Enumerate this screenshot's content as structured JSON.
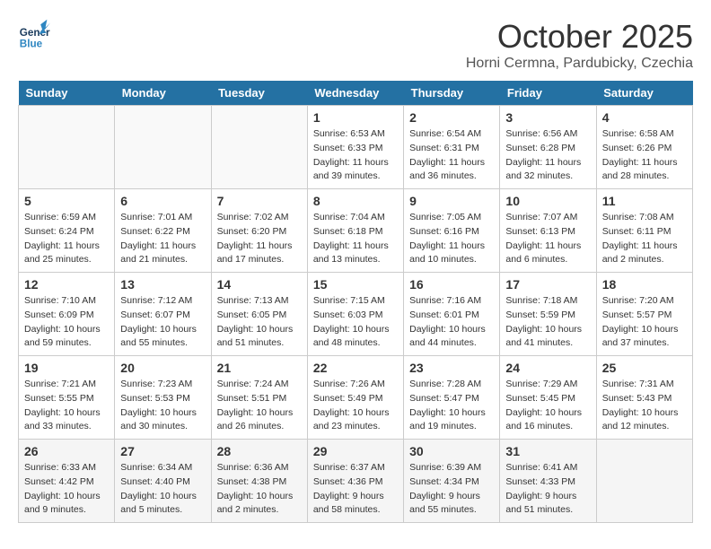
{
  "header": {
    "logo_general": "General",
    "logo_blue": "Blue",
    "month_title": "October 2025",
    "subtitle": "Horni Cermna, Pardubicky, Czechia"
  },
  "days_of_week": [
    "Sunday",
    "Monday",
    "Tuesday",
    "Wednesday",
    "Thursday",
    "Friday",
    "Saturday"
  ],
  "weeks": [
    [
      {
        "date": "",
        "info": ""
      },
      {
        "date": "",
        "info": ""
      },
      {
        "date": "",
        "info": ""
      },
      {
        "date": "1",
        "info": "Sunrise: 6:53 AM\nSunset: 6:33 PM\nDaylight: 11 hours\nand 39 minutes."
      },
      {
        "date": "2",
        "info": "Sunrise: 6:54 AM\nSunset: 6:31 PM\nDaylight: 11 hours\nand 36 minutes."
      },
      {
        "date": "3",
        "info": "Sunrise: 6:56 AM\nSunset: 6:28 PM\nDaylight: 11 hours\nand 32 minutes."
      },
      {
        "date": "4",
        "info": "Sunrise: 6:58 AM\nSunset: 6:26 PM\nDaylight: 11 hours\nand 28 minutes."
      }
    ],
    [
      {
        "date": "5",
        "info": "Sunrise: 6:59 AM\nSunset: 6:24 PM\nDaylight: 11 hours\nand 25 minutes."
      },
      {
        "date": "6",
        "info": "Sunrise: 7:01 AM\nSunset: 6:22 PM\nDaylight: 11 hours\nand 21 minutes."
      },
      {
        "date": "7",
        "info": "Sunrise: 7:02 AM\nSunset: 6:20 PM\nDaylight: 11 hours\nand 17 minutes."
      },
      {
        "date": "8",
        "info": "Sunrise: 7:04 AM\nSunset: 6:18 PM\nDaylight: 11 hours\nand 13 minutes."
      },
      {
        "date": "9",
        "info": "Sunrise: 7:05 AM\nSunset: 6:16 PM\nDaylight: 11 hours\nand 10 minutes."
      },
      {
        "date": "10",
        "info": "Sunrise: 7:07 AM\nSunset: 6:13 PM\nDaylight: 11 hours\nand 6 minutes."
      },
      {
        "date": "11",
        "info": "Sunrise: 7:08 AM\nSunset: 6:11 PM\nDaylight: 11 hours\nand 2 minutes."
      }
    ],
    [
      {
        "date": "12",
        "info": "Sunrise: 7:10 AM\nSunset: 6:09 PM\nDaylight: 10 hours\nand 59 minutes."
      },
      {
        "date": "13",
        "info": "Sunrise: 7:12 AM\nSunset: 6:07 PM\nDaylight: 10 hours\nand 55 minutes."
      },
      {
        "date": "14",
        "info": "Sunrise: 7:13 AM\nSunset: 6:05 PM\nDaylight: 10 hours\nand 51 minutes."
      },
      {
        "date": "15",
        "info": "Sunrise: 7:15 AM\nSunset: 6:03 PM\nDaylight: 10 hours\nand 48 minutes."
      },
      {
        "date": "16",
        "info": "Sunrise: 7:16 AM\nSunset: 6:01 PM\nDaylight: 10 hours\nand 44 minutes."
      },
      {
        "date": "17",
        "info": "Sunrise: 7:18 AM\nSunset: 5:59 PM\nDaylight: 10 hours\nand 41 minutes."
      },
      {
        "date": "18",
        "info": "Sunrise: 7:20 AM\nSunset: 5:57 PM\nDaylight: 10 hours\nand 37 minutes."
      }
    ],
    [
      {
        "date": "19",
        "info": "Sunrise: 7:21 AM\nSunset: 5:55 PM\nDaylight: 10 hours\nand 33 minutes."
      },
      {
        "date": "20",
        "info": "Sunrise: 7:23 AM\nSunset: 5:53 PM\nDaylight: 10 hours\nand 30 minutes."
      },
      {
        "date": "21",
        "info": "Sunrise: 7:24 AM\nSunset: 5:51 PM\nDaylight: 10 hours\nand 26 minutes."
      },
      {
        "date": "22",
        "info": "Sunrise: 7:26 AM\nSunset: 5:49 PM\nDaylight: 10 hours\nand 23 minutes."
      },
      {
        "date": "23",
        "info": "Sunrise: 7:28 AM\nSunset: 5:47 PM\nDaylight: 10 hours\nand 19 minutes."
      },
      {
        "date": "24",
        "info": "Sunrise: 7:29 AM\nSunset: 5:45 PM\nDaylight: 10 hours\nand 16 minutes."
      },
      {
        "date": "25",
        "info": "Sunrise: 7:31 AM\nSunset: 5:43 PM\nDaylight: 10 hours\nand 12 minutes."
      }
    ],
    [
      {
        "date": "26",
        "info": "Sunrise: 6:33 AM\nSunset: 4:42 PM\nDaylight: 10 hours\nand 9 minutes."
      },
      {
        "date": "27",
        "info": "Sunrise: 6:34 AM\nSunset: 4:40 PM\nDaylight: 10 hours\nand 5 minutes."
      },
      {
        "date": "28",
        "info": "Sunrise: 6:36 AM\nSunset: 4:38 PM\nDaylight: 10 hours\nand 2 minutes."
      },
      {
        "date": "29",
        "info": "Sunrise: 6:37 AM\nSunset: 4:36 PM\nDaylight: 9 hours\nand 58 minutes."
      },
      {
        "date": "30",
        "info": "Sunrise: 6:39 AM\nSunset: 4:34 PM\nDaylight: 9 hours\nand 55 minutes."
      },
      {
        "date": "31",
        "info": "Sunrise: 6:41 AM\nSunset: 4:33 PM\nDaylight: 9 hours\nand 51 minutes."
      },
      {
        "date": "",
        "info": ""
      }
    ]
  ]
}
